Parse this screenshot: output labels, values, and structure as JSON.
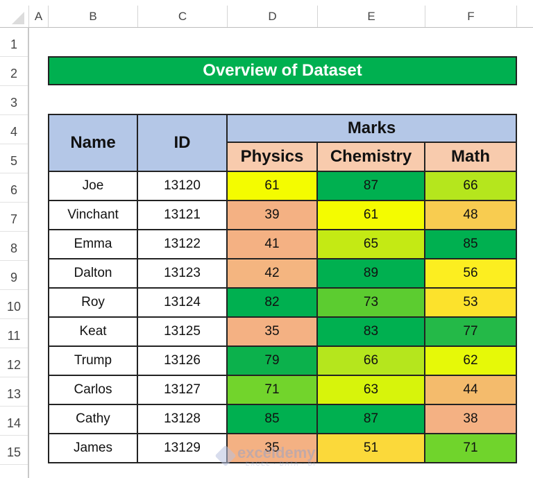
{
  "sheet": {
    "column_headers": [
      "A",
      "B",
      "C",
      "D",
      "E",
      "F"
    ],
    "row_headers": [
      "1",
      "2",
      "3",
      "4",
      "5",
      "6",
      "7",
      "8",
      "9",
      "10",
      "11",
      "12",
      "13",
      "14",
      "15"
    ]
  },
  "title": "Overview of Dataset",
  "table": {
    "header": {
      "name": "Name",
      "id": "ID",
      "marks": "Marks",
      "subjects": [
        "Physics",
        "Chemistry",
        "Math"
      ]
    },
    "rows": [
      {
        "name": "Joe",
        "id": "13120",
        "marks": [
          61,
          87,
          66
        ]
      },
      {
        "name": "Vinchant",
        "id": "13121",
        "marks": [
          39,
          61,
          48
        ]
      },
      {
        "name": "Emma",
        "id": "13122",
        "marks": [
          41,
          65,
          85
        ]
      },
      {
        "name": "Dalton",
        "id": "13123",
        "marks": [
          42,
          89,
          56
        ]
      },
      {
        "name": "Roy",
        "id": "13124",
        "marks": [
          82,
          73,
          53
        ]
      },
      {
        "name": "Keat",
        "id": "13125",
        "marks": [
          35,
          83,
          77
        ]
      },
      {
        "name": "Trump",
        "id": "13126",
        "marks": [
          79,
          66,
          62
        ]
      },
      {
        "name": "Carlos",
        "id": "13127",
        "marks": [
          71,
          63,
          44
        ]
      },
      {
        "name": "Cathy",
        "id": "13128",
        "marks": [
          85,
          87,
          38
        ]
      },
      {
        "name": "James",
        "id": "13129",
        "marks": [
          35,
          51,
          71
        ]
      }
    ],
    "mark_colors": [
      [
        "#f4fc00",
        "#00b050",
        "#b5e61d"
      ],
      [
        "#f4b183",
        "#f4fc00",
        "#f8cc50"
      ],
      [
        "#f4b183",
        "#c4ea14",
        "#00b050"
      ],
      [
        "#f4b580",
        "#00b050",
        "#fcee20"
      ],
      [
        "#00b050",
        "#5ccc30",
        "#fce22c"
      ],
      [
        "#f4b183",
        "#00b050",
        "#24b948"
      ],
      [
        "#0cb14c",
        "#b5e61d",
        "#e6f908"
      ],
      [
        "#72d42c",
        "#d7f40b",
        "#f4bb6c"
      ],
      [
        "#00b050",
        "#00b050",
        "#f4b183"
      ],
      [
        "#f4b183",
        "#fbd93a",
        "#70d42c"
      ]
    ]
  },
  "colors": {
    "title_bg": "#00b050",
    "header_bg": "#b4c7e7",
    "subject_header_bg": "#f8cbad"
  },
  "watermark": {
    "brand": "exceldemy",
    "tagline": "EXCEL · DATA · BI"
  }
}
